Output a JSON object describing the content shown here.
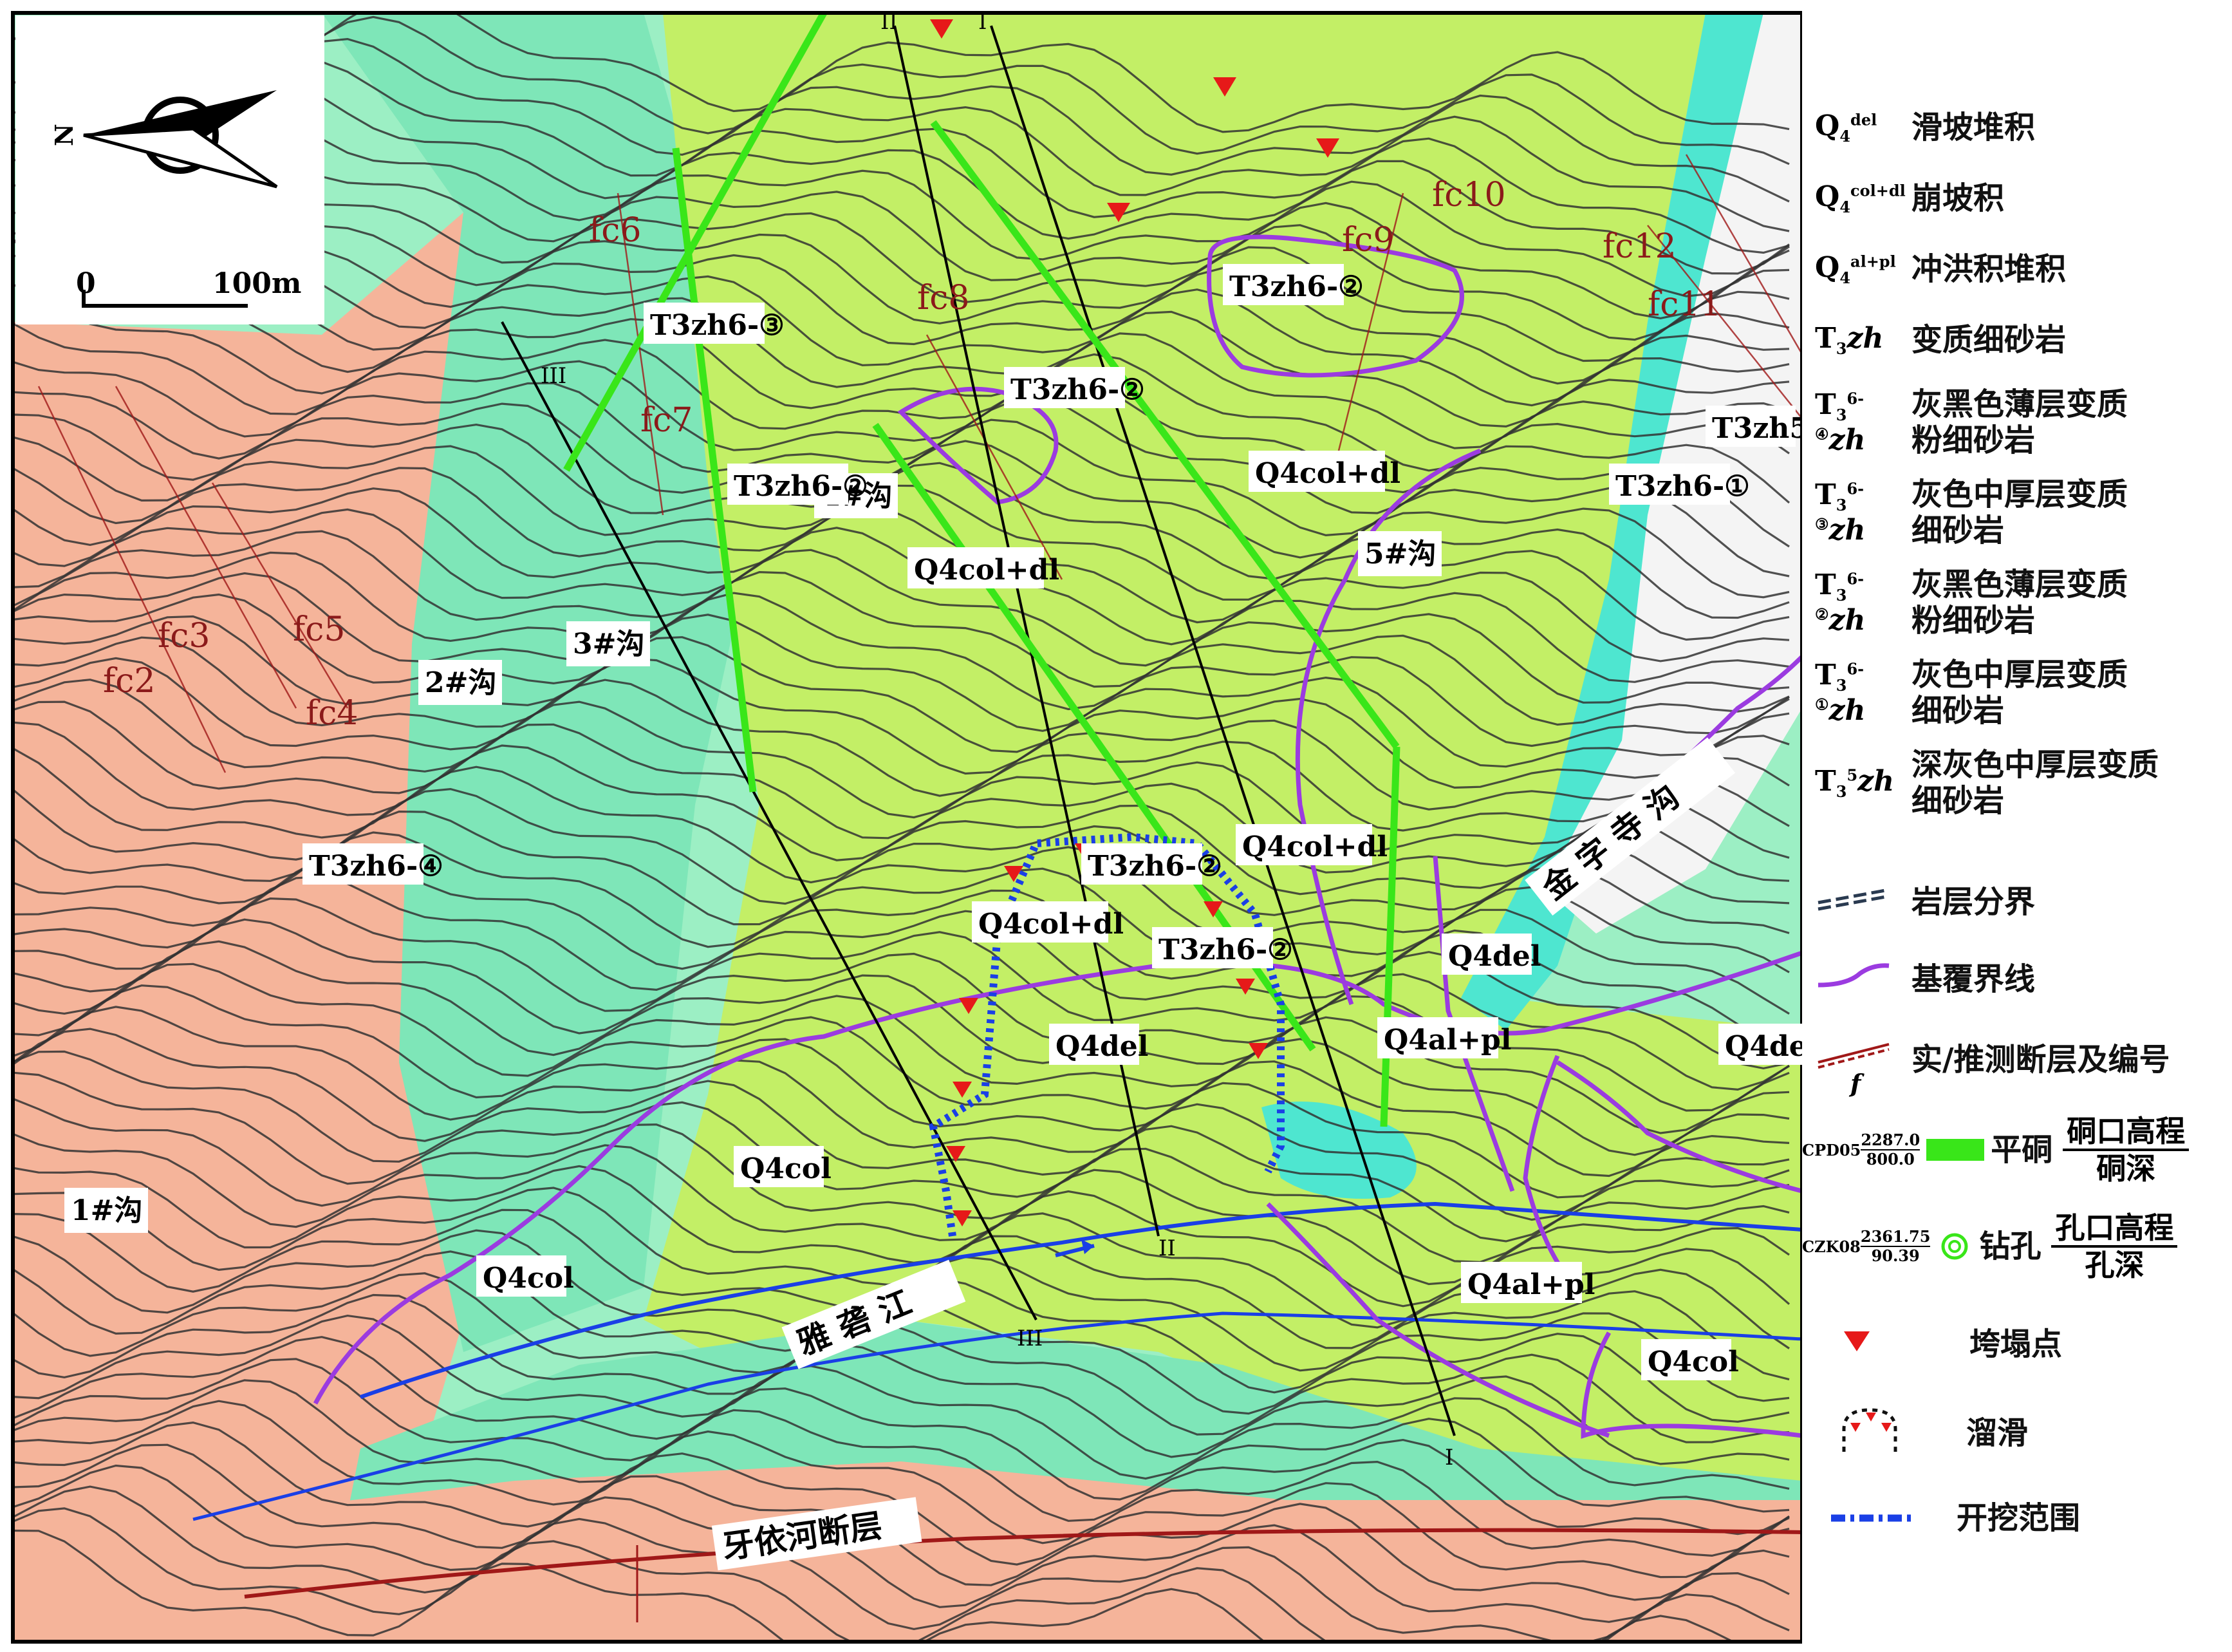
{
  "map": {
    "north_label": "N",
    "scale": {
      "zero": "0",
      "end": "100m"
    },
    "gullies": [
      "1#沟",
      "2#沟",
      "3#沟",
      "4#沟",
      "5#沟"
    ],
    "river": "雅 砻 江",
    "side_gully": "金 字 寺 沟",
    "fault_name": "牙依河断层",
    "section_marks": [
      "I",
      "II",
      "III"
    ],
    "faults": [
      "fc2",
      "fc3",
      "fc4",
      "fc5",
      "fc6",
      "fc7",
      "fc8",
      "fc9",
      "fc10",
      "fc11",
      "fc12"
    ],
    "units": {
      "q_del": "Q4del",
      "q_col": "Q4col",
      "q_coldl": "Q4col+dl",
      "q_alpl": "Q4al+pl",
      "t3zh": "T3zh",
      "t_64": "T3zh6-④",
      "t_63": "T3zh6-③",
      "t_62": "T3zh6-②",
      "t_61": "T3zh6-①",
      "t_5": "T3zh5"
    },
    "colors": {
      "orange_zone": "#f5b49a",
      "light_teal": "#9cefc4",
      "mid_teal": "#7ee6b8",
      "yellow_green": "#c3ef66",
      "cyan_band": "#4ee6d0",
      "white_zone": "#f4f4f4",
      "adit_green": "#39e619",
      "boundary_purple": "#9b3be0",
      "excavation_blue": "#1a3fe6",
      "fault_red": "#a01818"
    }
  },
  "legend": {
    "items": [
      {
        "sym": "Q",
        "sub": "4",
        "sup": "del",
        "text": "滑坡堆积"
      },
      {
        "sym": "Q",
        "sub": "4",
        "sup": "col+dl",
        "text": "崩坡积"
      },
      {
        "sym": "Q",
        "sub": "4",
        "sup": "al+pl",
        "text": "冲洪积堆积"
      },
      {
        "sym": "T",
        "sub": "3",
        "sup": "",
        "ital": "zh",
        "text": "变质细砂岩"
      },
      {
        "sym": "T",
        "sub": "3",
        "sup": "6-④",
        "ital": "zh",
        "text": "灰黑色薄层变质\n粉细砂岩"
      },
      {
        "sym": "T",
        "sub": "3",
        "sup": "6-③",
        "ital": "zh",
        "text": "灰色中厚层变质\n细砂岩"
      },
      {
        "sym": "T",
        "sub": "3",
        "sup": "6-②",
        "ital": "zh",
        "text": "灰黑色薄层变质\n粉细砂岩"
      },
      {
        "sym": "T",
        "sub": "3",
        "sup": "6-①",
        "ital": "zh",
        "text": "灰色中厚层变质\n细砂岩"
      },
      {
        "sym": "T",
        "sub": "3",
        "sup": "5",
        "ital": "zh",
        "text": "深灰色中厚层变质\n细砂岩"
      }
    ],
    "bed_boundary": "岩层分界",
    "bedrock_line": "基覆界线",
    "fault_line": "实/推测断层及编号",
    "fault_letter": "f",
    "adit": {
      "code": "CPD05",
      "top": "2287.0",
      "bottom": "800.0",
      "label": "平硐",
      "ftop": "硐口高程",
      "fbottom": "硐深"
    },
    "borehole": {
      "code": "CZK08",
      "top": "2361.75",
      "bottom": "90.39",
      "label": "钻孔",
      "ftop": "孔口高程",
      "fbottom": "孔深"
    },
    "collapse": "垮塌点",
    "slide": "溜滑",
    "excavation": "开挖范围"
  }
}
